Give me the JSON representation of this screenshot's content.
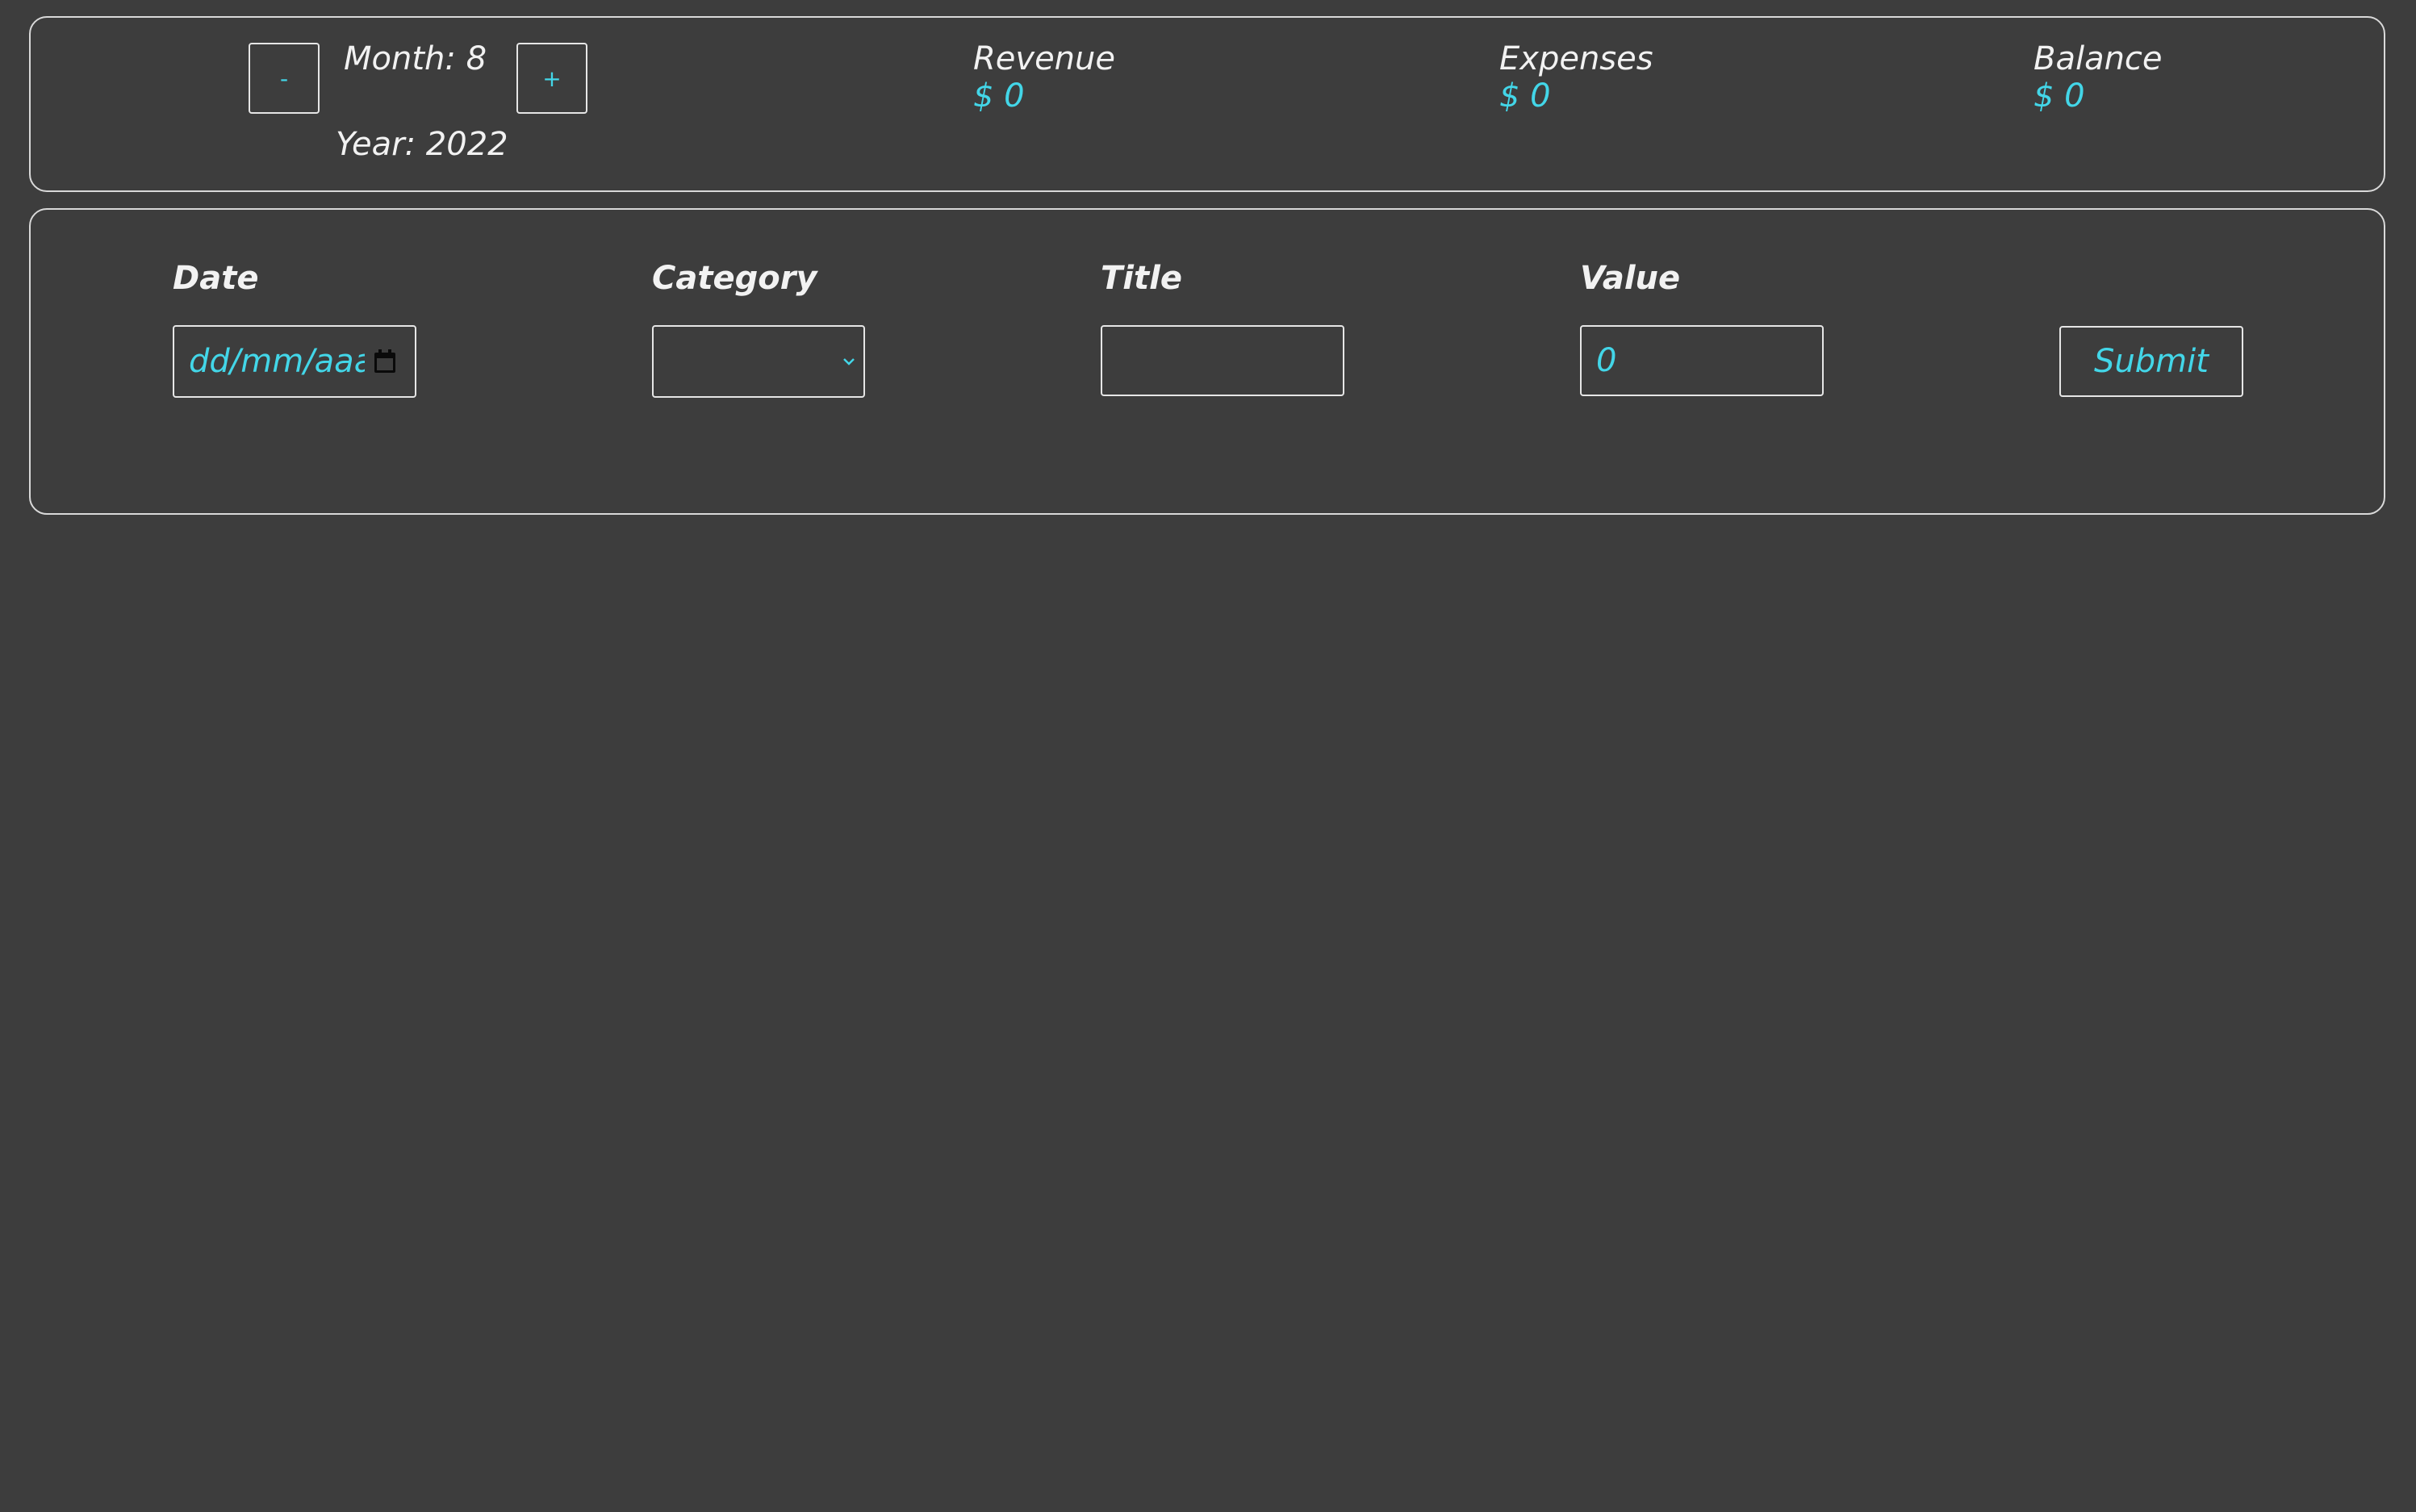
{
  "header": {
    "decrement_label": "-",
    "increment_label": "+",
    "month_text": "Month: 8",
    "year_text": "Year: 2022",
    "summary": [
      {
        "label": "Revenue",
        "value": "$ 0"
      },
      {
        "label": "Expenses",
        "value": "$ 0"
      },
      {
        "label": "Balance",
        "value": "$ 0"
      }
    ]
  },
  "form": {
    "date_label": "Date",
    "date_placeholder": "dd/mm/aaaa",
    "category_label": "Category",
    "category_selected": "",
    "title_label": "Title",
    "title_value": "",
    "value_label": "Value",
    "value_placeholder": "0",
    "submit_label": "Submit"
  },
  "colors": {
    "background": "#3d3d3d",
    "accent": "#43d6e8",
    "text": "#f2f2f2",
    "border": "#d9d9d9"
  },
  "icons": {
    "date": "calendar-icon",
    "category": "chevron-down-icon"
  }
}
